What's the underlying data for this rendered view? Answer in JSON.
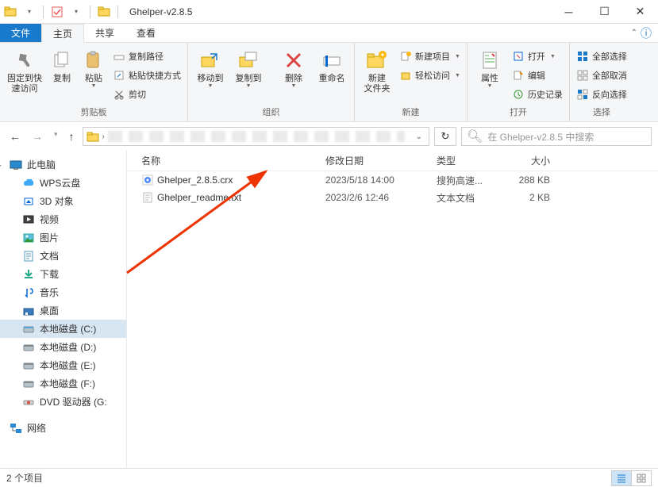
{
  "window": {
    "title": "Ghelper-v2.8.5"
  },
  "tabs": {
    "file": "文件",
    "home": "主页",
    "share": "共享",
    "view": "查看"
  },
  "ribbon": {
    "groups": {
      "clipboard": {
        "pin": "固定到快\n速访问",
        "copy": "复制",
        "paste": "粘贴",
        "copypath": "复制路径",
        "pasteshortcut": "粘贴快捷方式",
        "cut": "剪切",
        "label": "剪贴板"
      },
      "organize": {
        "moveto": "移动到",
        "copyto": "复制到",
        "delete": "删除",
        "rename": "重命名",
        "label": "组织"
      },
      "new": {
        "newfolder": "新建\n文件夹",
        "newitem": "新建项目",
        "easyaccess": "轻松访问",
        "label": "新建"
      },
      "open": {
        "properties": "属性",
        "open": "打开",
        "edit": "编辑",
        "history": "历史记录",
        "label": "打开"
      },
      "select": {
        "selectall": "全部选择",
        "selectnone": "全部取消",
        "invert": "反向选择",
        "label": "选择"
      }
    }
  },
  "searchPlaceholder": "在 Ghelper-v2.8.5 中搜索",
  "nav": {
    "thispc": "此电脑",
    "items": [
      {
        "label": "WPS云盘"
      },
      {
        "label": "3D 对象"
      },
      {
        "label": "视频"
      },
      {
        "label": "图片"
      },
      {
        "label": "文档"
      },
      {
        "label": "下载"
      },
      {
        "label": "音乐"
      },
      {
        "label": "桌面"
      },
      {
        "label": "本地磁盘 (C:)"
      },
      {
        "label": "本地磁盘 (D:)"
      },
      {
        "label": "本地磁盘 (E:)"
      },
      {
        "label": "本地磁盘 (F:)"
      },
      {
        "label": "DVD 驱动器 (G:"
      }
    ],
    "network": "网络"
  },
  "columns": {
    "name": "名称",
    "date": "修改日期",
    "type": "类型",
    "size": "大小"
  },
  "files": [
    {
      "name": "Ghelper_2.8.5.crx",
      "date": "2023/5/18 14:00",
      "type": "搜狗高速...",
      "size": "288 KB",
      "icon": "crx"
    },
    {
      "name": "Ghelper_readme.txt",
      "date": "2023/2/6 12:46",
      "type": "文本文档",
      "size": "2 KB",
      "icon": "txt"
    }
  ],
  "status": "2 个项目"
}
